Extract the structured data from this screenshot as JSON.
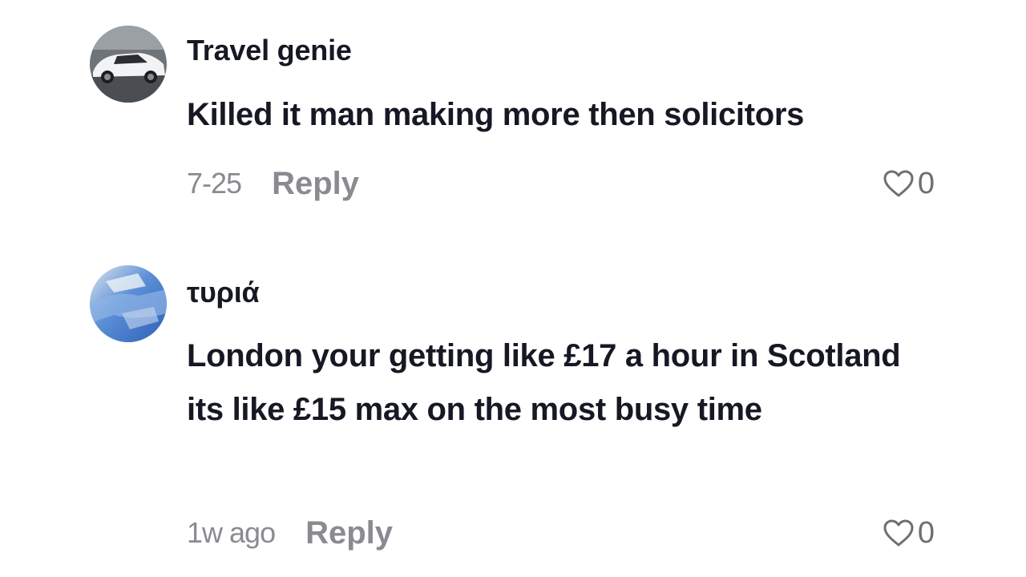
{
  "comments": [
    {
      "username": "Travel genie",
      "text": "Killed it man making more then solicitors",
      "timestamp": "7-25",
      "reply_label": "Reply",
      "likes": "0",
      "avatar_icon": "car-photo-avatar"
    },
    {
      "username": "τυριά",
      "text": "London your getting like £17 a hour in Scotland its like £15 max on the most busy time",
      "timestamp": "1w ago",
      "reply_label": "Reply",
      "likes": "0",
      "avatar_icon": "blue-abstract-avatar"
    }
  ],
  "colors": {
    "text_primary": "#161823",
    "text_secondary": "#8a8b91",
    "like_icon": "#6e6f75"
  }
}
